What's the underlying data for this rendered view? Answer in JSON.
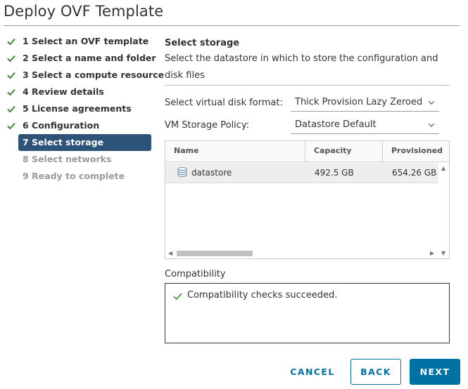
{
  "window": {
    "title": "Deploy OVF Template"
  },
  "steps": [
    {
      "label": "1 Select an OVF template",
      "state": "done"
    },
    {
      "label": "2 Select a name and folder",
      "state": "done"
    },
    {
      "label": "3 Select a compute resource",
      "state": "done"
    },
    {
      "label": "4 Review details",
      "state": "done"
    },
    {
      "label": "5 License agreements",
      "state": "done"
    },
    {
      "label": "6 Configuration",
      "state": "done"
    },
    {
      "label": "7 Select storage",
      "state": "active"
    },
    {
      "label": "8 Select networks",
      "state": "pending"
    },
    {
      "label": "9 Ready to complete",
      "state": "pending"
    }
  ],
  "section": {
    "title": "Select storage",
    "description": "Select the datastore in which to store the configuration and disk files"
  },
  "disk_format": {
    "label": "Select virtual disk format:",
    "value": "Thick Provision Lazy Zeroed"
  },
  "storage_policy": {
    "label": "VM Storage Policy:",
    "value": "Datastore Default"
  },
  "grid": {
    "columns": [
      "Name",
      "Capacity",
      "Provisioned"
    ],
    "rows": [
      {
        "name": "datastore",
        "capacity": "492.5 GB",
        "provisioned": "654.26 GB"
      }
    ],
    "icon": "datastore-icon"
  },
  "compatibility": {
    "label": "Compatibility",
    "message": "Compatibility checks succeeded."
  },
  "buttons": {
    "cancel": "CANCEL",
    "back": "BACK",
    "next": "NEXT"
  },
  "colors": {
    "active_step_bg": "#2e5378",
    "check_green": "#3c8c30",
    "primary": "#0072a3",
    "pending_text": "#9a9a9a"
  }
}
